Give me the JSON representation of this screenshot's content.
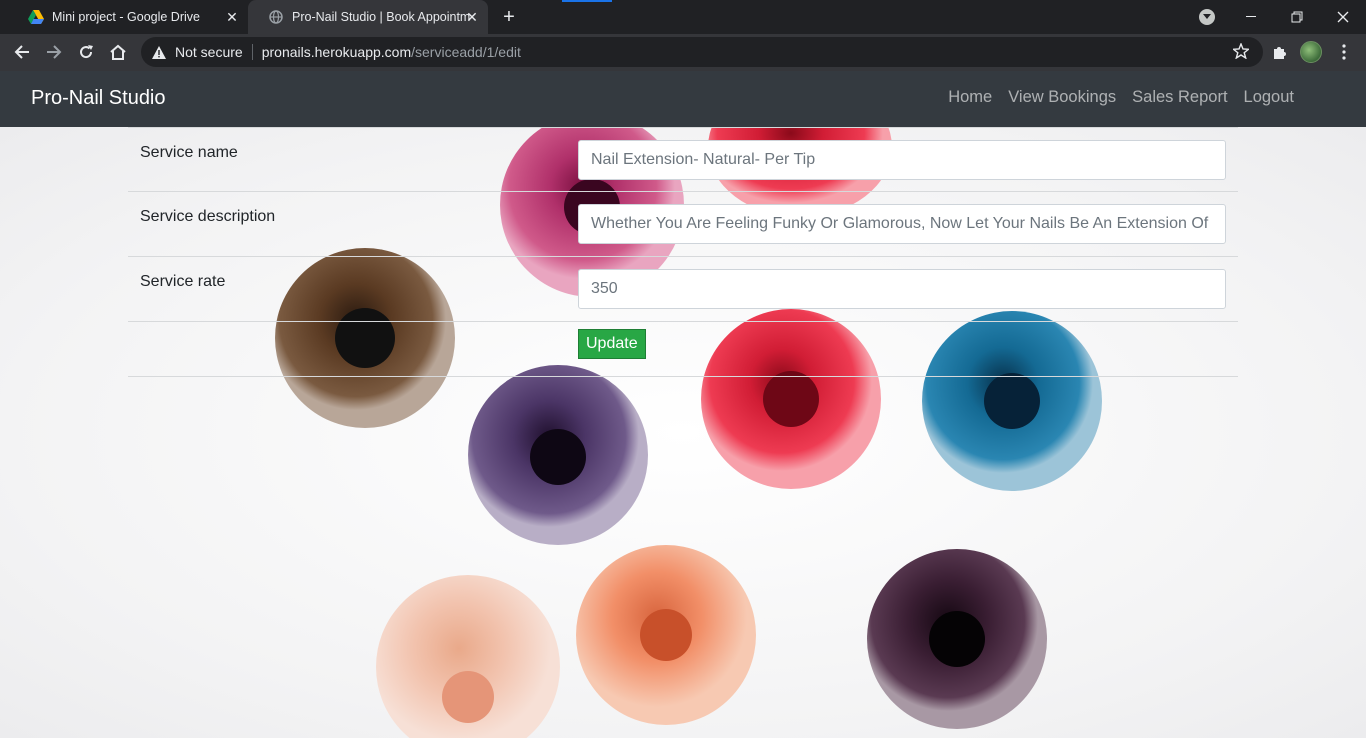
{
  "browser": {
    "tabs": [
      {
        "title": "Mini project - Google Drive",
        "favicon": "google-drive-icon"
      },
      {
        "title": "Pro-Nail Studio | Book Appointm",
        "favicon": "globe-icon"
      }
    ],
    "security_label": "Not secure",
    "url_host": "pronails.herokuapp.com",
    "url_path": "/serviceadd/1/edit"
  },
  "navbar": {
    "brand": "Pro-Nail Studio",
    "links": [
      "Home",
      "View Bookings",
      "Sales Report",
      "Logout"
    ]
  },
  "form": {
    "service_name_label": "Service name",
    "service_name_value": "Nail Extension- Natural- Per Tip",
    "service_description_label": "Service description",
    "service_description_value": "Whether You Are Feeling Funky Or Glamorous, Now Let Your Nails Be An Extension Of",
    "service_rate_label": "Service rate",
    "service_rate_value": "350",
    "update_label": "Update"
  },
  "colors": {
    "navbar_bg": "#343a40",
    "update_button": "#28a745"
  }
}
